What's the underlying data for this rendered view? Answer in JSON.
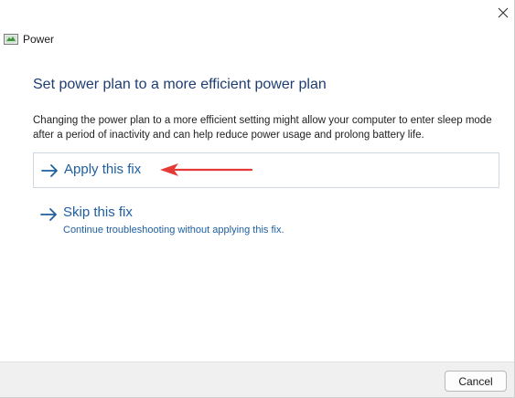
{
  "window": {
    "title": "Power",
    "close_icon": "close-icon",
    "app_icon": "troubleshooter-icon"
  },
  "main": {
    "heading": "Set power plan to a more efficient power plan",
    "description": "Changing the power plan to a more efficient setting might allow your computer to enter sleep mode after a period of inactivity and can help reduce power usage and prolong battery life.",
    "apply": {
      "label": "Apply this fix",
      "icon": "arrow-right-icon"
    },
    "skip": {
      "label": "Skip this fix",
      "sublabel": "Continue troubleshooting without applying this fix.",
      "icon": "arrow-right-icon"
    },
    "annotation": {
      "icon": "red-arrow-annotation",
      "color": "#e53935"
    }
  },
  "footer": {
    "cancel_label": "Cancel"
  },
  "colors": {
    "heading": "#1e3d73",
    "link": "#1e5fa0",
    "footer_bg": "#f0f0f0"
  }
}
